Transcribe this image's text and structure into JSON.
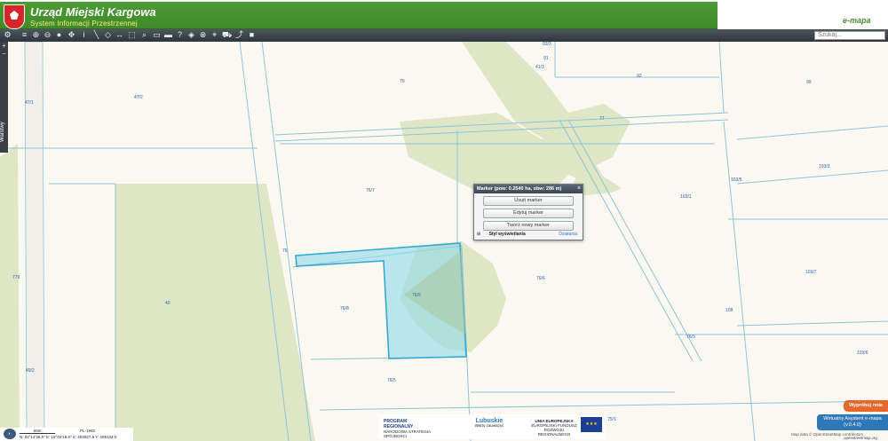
{
  "header": {
    "title": "Urząd Miejski Kargowa",
    "subtitle": "System Informacji Przestrzennej",
    "logo_text": "e-mapa",
    "search_placeholder": "Szukaj..."
  },
  "colors": {
    "header_green": "#4d9a35",
    "toolbar_dark": "#3b4048",
    "map_background": "#fbf8f2",
    "forest": "#dfe6c6",
    "parcel_line": "#8cc5d6",
    "selection_fill": "#8fd8ea",
    "selection_stroke": "#34a9cf"
  },
  "toolbar_icons": [
    "layers-icon",
    "zoom-in-icon",
    "zoom-out-icon",
    "full-extent-icon",
    "pan-icon",
    "info-icon",
    "measure-line-icon",
    "measure-area-icon",
    "measure-distance-icon",
    "print-icon",
    "select-icon",
    "search-parcel-icon",
    "help-icon",
    "bookmark-icon",
    "marker-icon",
    "cart-icon",
    "share-icon"
  ],
  "left_panel": {
    "tab_label": "Warstwy"
  },
  "parcels": [
    "93/3",
    "91",
    "41/3",
    "79",
    "92",
    "99",
    "47/2",
    "47/1",
    "77",
    "103/3",
    "103/5",
    "103/1",
    "76/7",
    "76",
    "76/9",
    "76/8",
    "76/6",
    "103/7",
    "779",
    "40",
    "108",
    "76/3",
    "49/2",
    "103/6",
    "76/5",
    "75/1"
  ],
  "popup": {
    "title": "Marker (pow: 0.2540 ha, obw: 286 m)",
    "close": "×",
    "buttons": [
      "Usuń marker",
      "Edytuj marker",
      "Twórz nowy marker"
    ],
    "style_label": "Styl wyświetlania",
    "actions_label": "Działania"
  },
  "footer": {
    "logos": [
      "PROGRAM REGIONALNY",
      "Lubuskie",
      "UNIA EUROPEJSKA"
    ],
    "logo_sub": [
      "NARODOWA STRATEGIA SPÓJNOŚCI",
      "Warto zauważyć",
      "EUROPEJSKI FUNDUSZ ROZWOJU REGIONALNEGO"
    ],
    "try_button": "Wypróbuj nnie",
    "assistant_button": "Wirtualny Asystent e-mapa (v.0.4.0)",
    "attribution": "Map data © OpenStreetMap contributors",
    "osm": "openstreetmap.org",
    "scale_label": "50m",
    "projection": "PL-1992",
    "coords": "N: 52°14'26.5\"  E: 16°04'18.6\"  X: 403927.5  Y: 209134.0"
  }
}
